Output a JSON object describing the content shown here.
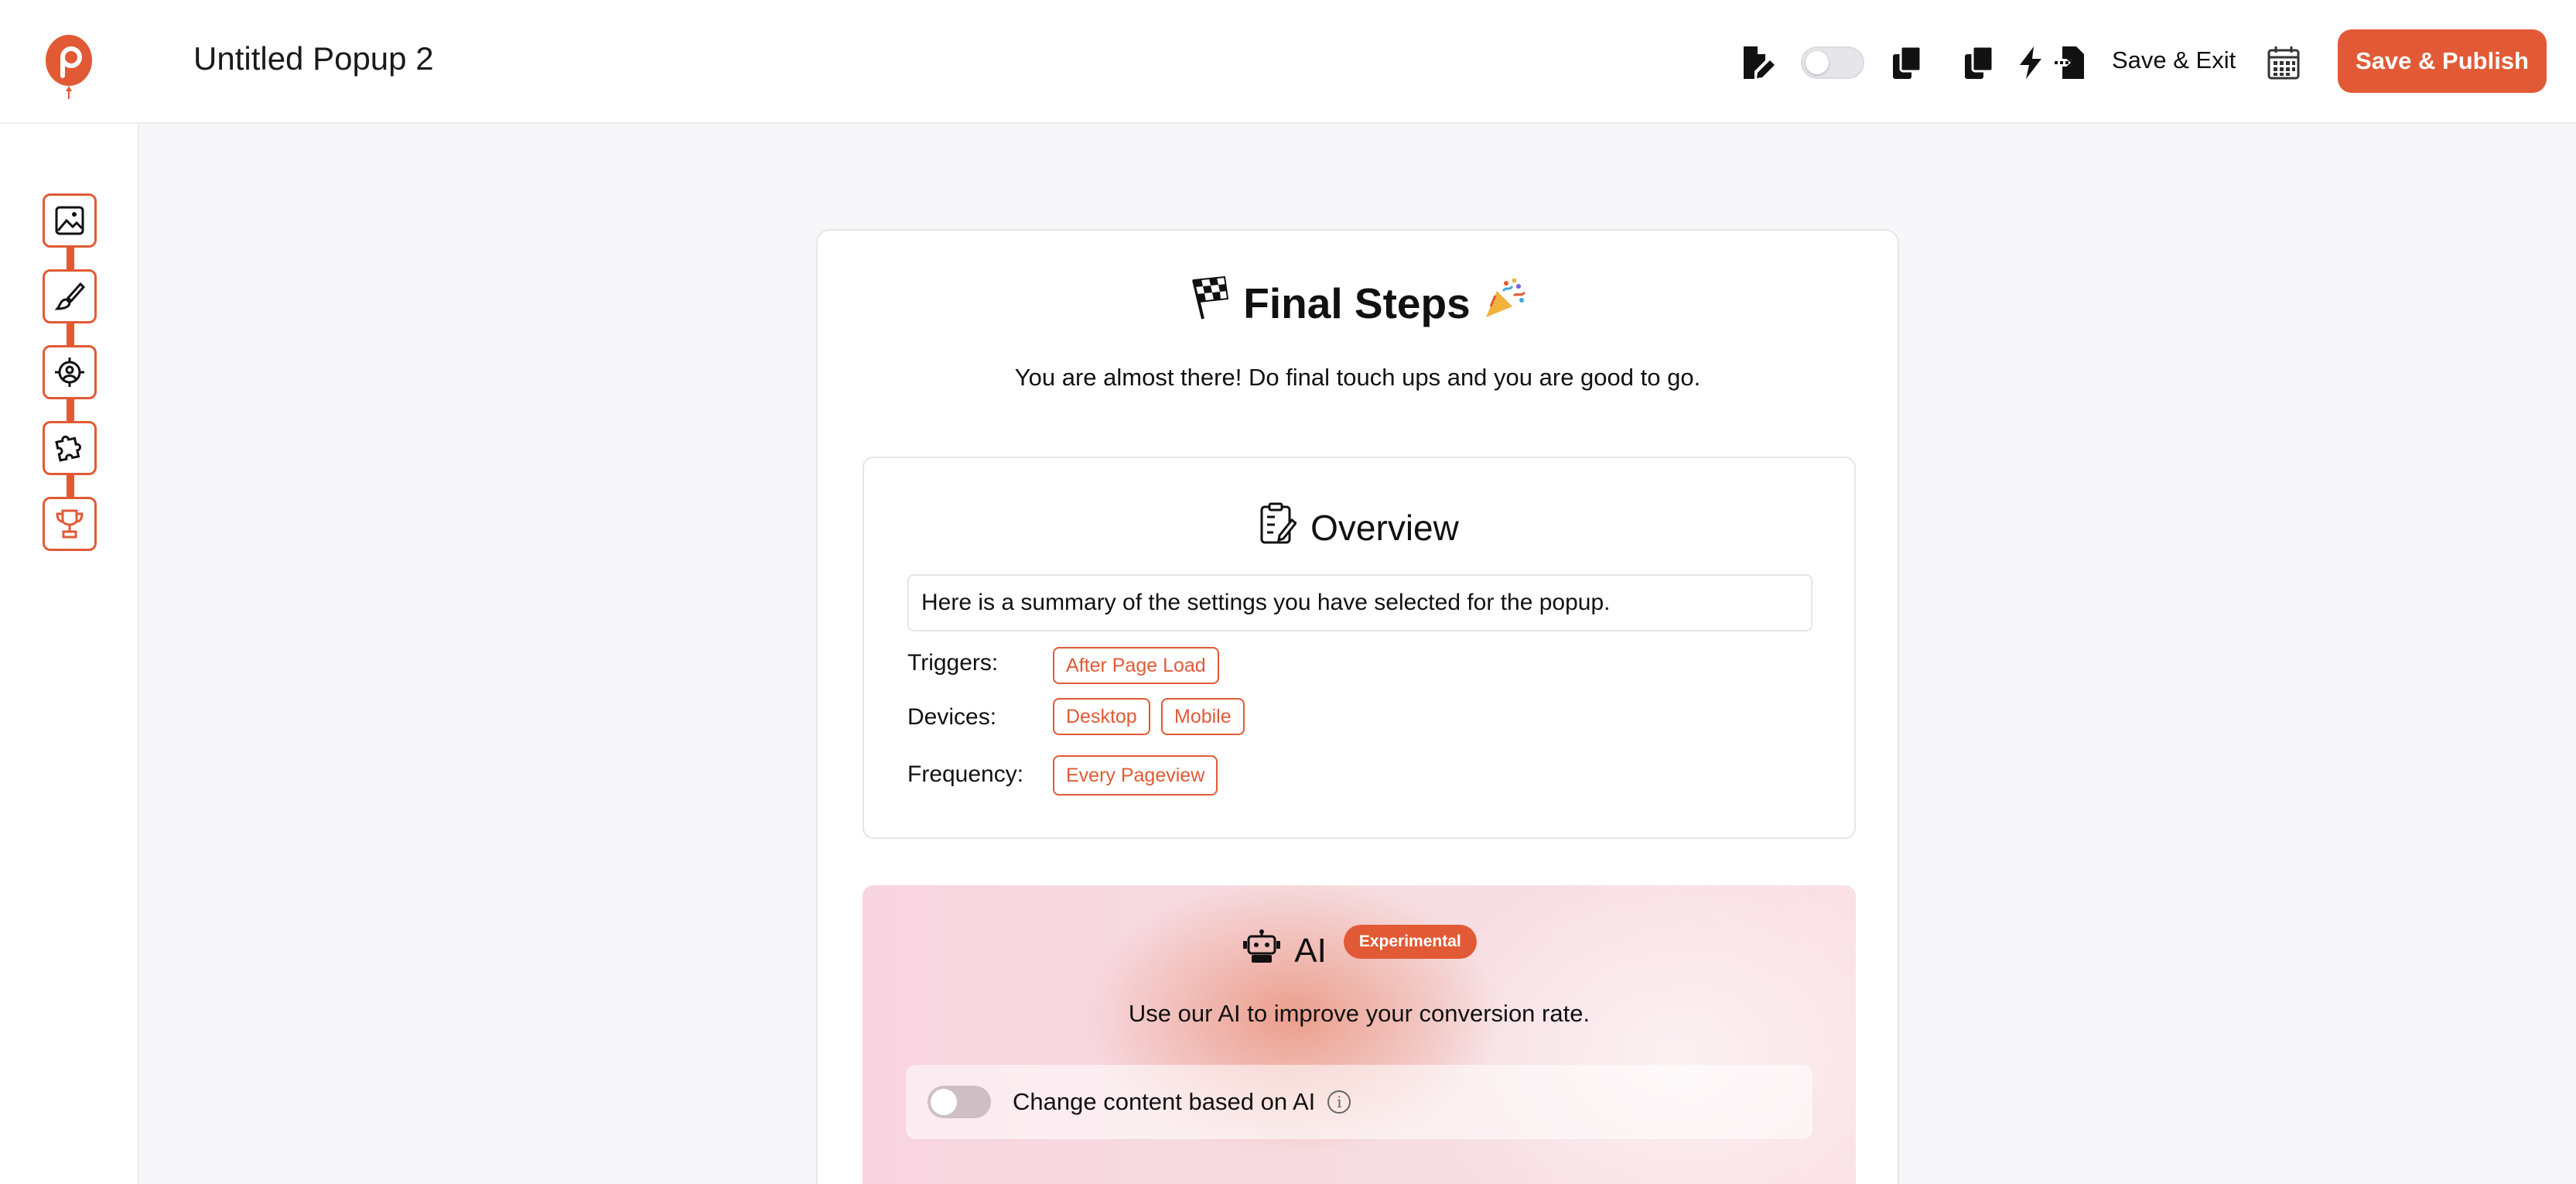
{
  "header": {
    "title": "Untitled Popup 2",
    "save_exit_label": "Save & Exit",
    "publish_label": "Save & Publish",
    "icons": [
      "edit-file-icon",
      "toggle-switch",
      "copy-icon",
      "duplicate-icon",
      "lightning-icon",
      "file-import-icon",
      "calendar-icon"
    ]
  },
  "sidebar": {
    "steps": [
      "image-icon",
      "brush-icon",
      "target-icon",
      "puzzle-icon",
      "trophy-icon"
    ]
  },
  "main": {
    "title": "Final Steps",
    "subtitle": "You are almost there! Do final touch ups and you are good to go.",
    "overview": {
      "title": "Overview",
      "summary": "Here is a summary of the settings you have selected for the popup.",
      "triggers_label": "Triggers:",
      "triggers": [
        "After Page Load"
      ],
      "devices_label": "Devices:",
      "devices": [
        "Desktop",
        "Mobile"
      ],
      "frequency_label": "Frequency:",
      "frequency": [
        "Every Pageview"
      ]
    },
    "ai": {
      "title": "AI",
      "badge": "Experimental",
      "subtitle": "Use our AI to improve your conversion rate.",
      "toggle_label": "Change content based on AI"
    }
  },
  "colors": {
    "accent": "#e15a35",
    "background": "#f7f7f9"
  }
}
